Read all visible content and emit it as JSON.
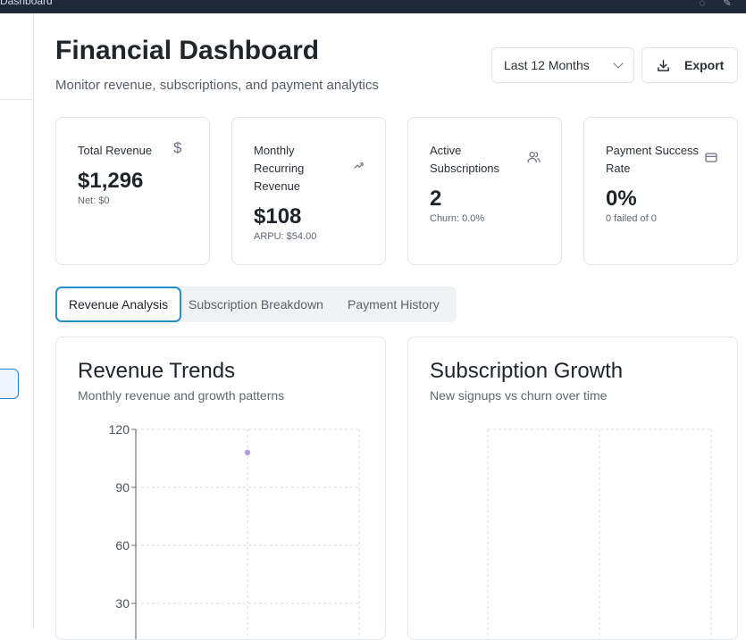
{
  "window": {
    "tab_title": "Dashboard"
  },
  "header": {
    "title": "Financial Dashboard",
    "subtitle": "Monitor revenue, subscriptions, and payment analytics",
    "period_select": "Last 12 Months",
    "export_label": "Export"
  },
  "cards": [
    {
      "label": "Total Revenue",
      "value": "$1,296",
      "sub": "Net: $0",
      "icon": "dollar-icon"
    },
    {
      "label": "Monthly Recurring Revenue",
      "value": "$108",
      "sub": "ARPU: $54.00",
      "icon": "trending-up-icon"
    },
    {
      "label": "Active Subscriptions",
      "value": "2",
      "sub": "Churn: 0.0%",
      "icon": "users-icon"
    },
    {
      "label": "Payment Success Rate",
      "value": "0%",
      "sub": "0 failed of 0",
      "icon": "credit-card-icon"
    }
  ],
  "tabs": [
    "Revenue Analysis",
    "Subscription Breakdown",
    "Payment History"
  ],
  "panels": {
    "revenue": {
      "title": "Revenue Trends",
      "subtitle": "Monthly revenue and growth patterns"
    },
    "subscriptions": {
      "title": "Subscription Growth",
      "subtitle": "New signups vs churn over time"
    }
  },
  "chart_data": [
    {
      "type": "line",
      "title": "Revenue Trends",
      "y_ticks": [
        120,
        90,
        60,
        30
      ],
      "ylim": [
        0,
        120
      ],
      "points": [
        {
          "x": 1,
          "y": 108
        }
      ],
      "xlim": [
        0,
        2
      ],
      "grid": true,
      "color": "#a78bde"
    },
    {
      "type": "line",
      "title": "Subscription Growth",
      "grid": true,
      "series": []
    }
  ],
  "colors": {
    "accent": "#2590c9",
    "topbar": "#1e2a3a"
  }
}
